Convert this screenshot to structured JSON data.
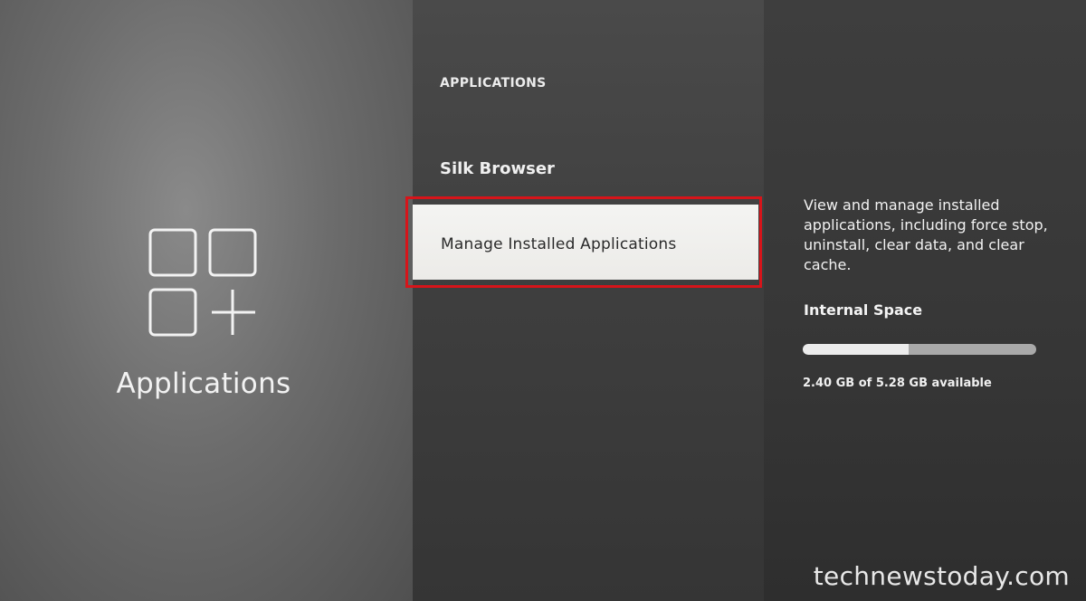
{
  "sidebar": {
    "category_title": "Applications",
    "icon": "apps-grid-add-icon"
  },
  "menu": {
    "header": "APPLICATIONS",
    "items": [
      {
        "label": "Silk Browser"
      },
      {
        "label": "Manage Installed Applications",
        "selected": true
      }
    ]
  },
  "details": {
    "description": "View and manage installed applications, including force stop, uninstall, clear data, and clear cache.",
    "storage_title": "Internal Space",
    "storage_text": "2.40 GB of 5.28 GB available",
    "storage_fraction_available": 0.455
  },
  "watermark": "technewstoday.com",
  "colors": {
    "highlight_border": "#d7141a",
    "selected_bg": "#f0f0ee"
  }
}
